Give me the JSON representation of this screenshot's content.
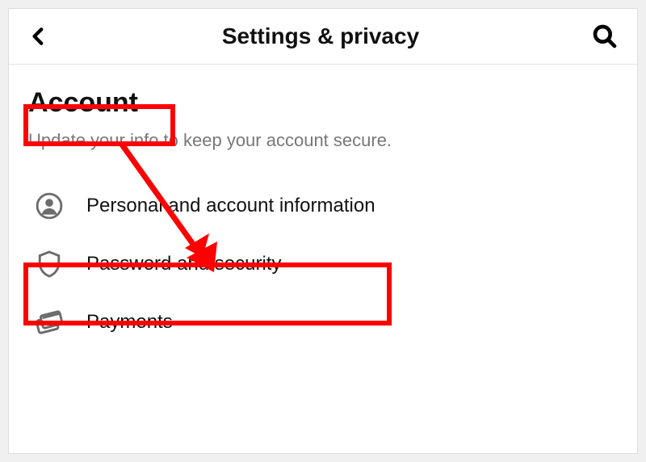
{
  "header": {
    "title": "Settings & privacy"
  },
  "section": {
    "title": "Account",
    "subtitle": "Update your info to keep your account secure."
  },
  "menu": {
    "items": [
      {
        "label": "Personal and account information",
        "icon": "user-circle-icon"
      },
      {
        "label": "Password and security",
        "icon": "shield-icon"
      },
      {
        "label": "Payments",
        "icon": "cards-icon"
      }
    ]
  }
}
